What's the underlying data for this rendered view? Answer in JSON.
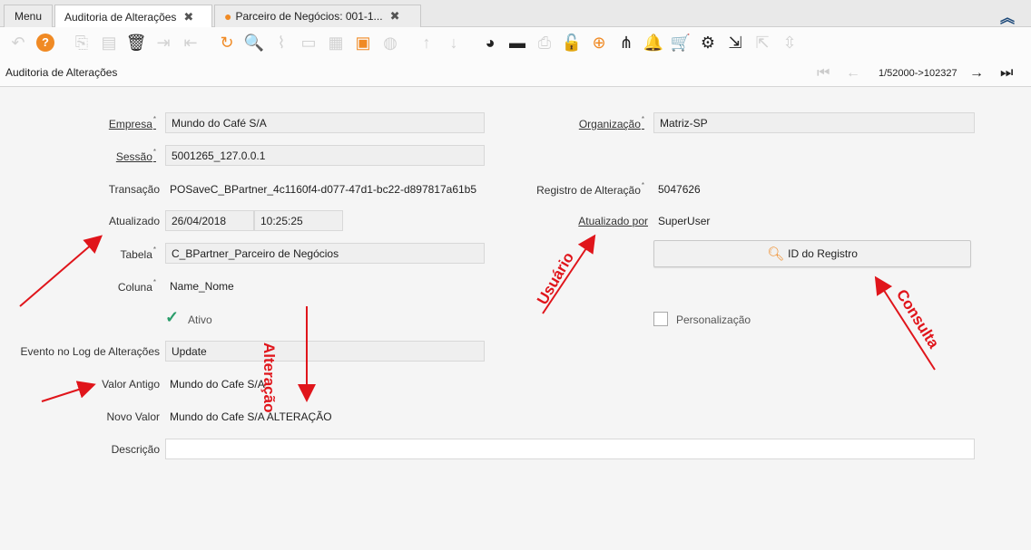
{
  "tabs": {
    "menu": "Menu",
    "auditoria": "Auditoria de Alterações",
    "parceiro": "Parceiro de Negócios: 001-1...",
    "close_glyph": "✖"
  },
  "header": {
    "title": "Auditoria de Alterações",
    "record_info": "1/52000->102327"
  },
  "form": {
    "empresa_label": "Empresa",
    "empresa_value": "Mundo do Café S/A",
    "sessao_label": "Sessão",
    "sessao_value": "5001265_127.0.0.1",
    "transacao_label": "Transação",
    "transacao_value": "POSaveC_BPartner_4c1160f4-d077-47d1-bc22-d897817a61b5",
    "atualizado_label": "Atualizado",
    "atualizado_date": "26/04/2018",
    "atualizado_time": "10:25:25",
    "tabela_label": "Tabela",
    "tabela_value": "C_BPartner_Parceiro de Negócios",
    "coluna_label": "Coluna",
    "coluna_value": "Name_Nome",
    "ativo_label": "Ativo",
    "evento_label": "Evento no Log de Alterações",
    "evento_value": "Update",
    "valor_antigo_label": "Valor Antigo",
    "valor_antigo_value": "Mundo do Cafe S/A",
    "novo_valor_label": "Novo Valor",
    "novo_valor_value": "Mundo do Cafe S/A ALTERAÇÃO",
    "descricao_label": "Descrição",
    "descricao_value": "",
    "organizacao_label": "Organização",
    "organizacao_value": "Matriz-SP",
    "registro_label": "Registro de Alteração",
    "registro_value": "5047626",
    "atualizado_por_label": "Atualizado por",
    "atualizado_por_value": "SuperUser",
    "id_registro_button": "ID do Registro",
    "personalizacao_label": "Personalização",
    "required_mark": "*"
  },
  "annotations": {
    "alteracao": "Alteração",
    "usuario": "Usuário",
    "consulta": "Consulta"
  },
  "colors": {
    "annotation": "#e0151b",
    "accent": "#f08a24"
  }
}
